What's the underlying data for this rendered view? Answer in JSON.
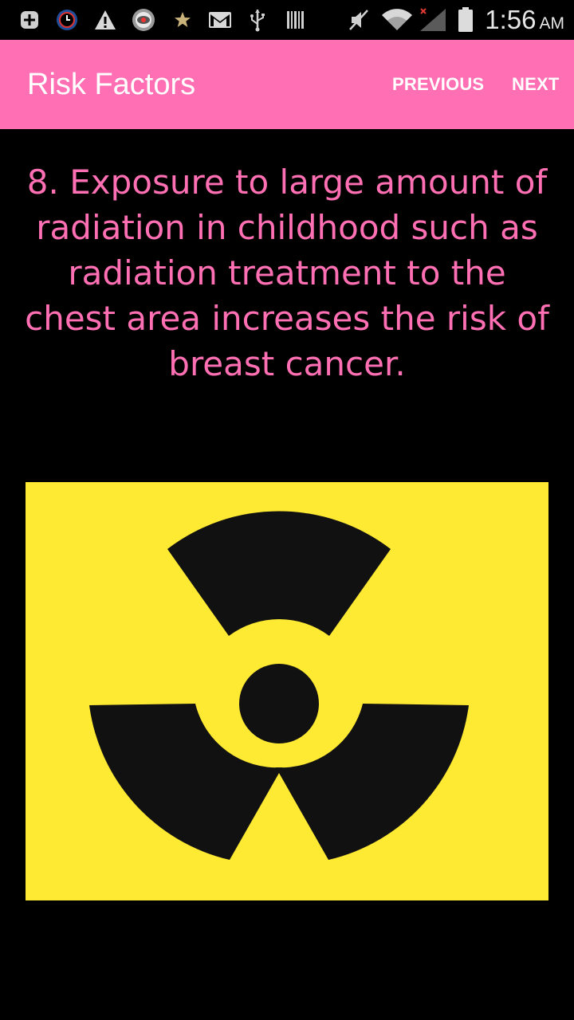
{
  "status_bar": {
    "time": "1:56",
    "ampm": "AM",
    "icons": [
      "plus-box-icon",
      "clock-app-icon",
      "warning-icon",
      "eye-app-icon",
      "star-icon",
      "gmail-icon",
      "usb-icon",
      "barcode-icon",
      "mute-icon",
      "wifi-icon",
      "signal-icon",
      "battery-icon"
    ]
  },
  "app_bar": {
    "title": "Risk Factors",
    "previous_label": "PREVIOUS",
    "next_label": "NEXT",
    "color": "#ff6fb3"
  },
  "content": {
    "fact": "8. Exposure to large amount of radiation in childhood such as radiation treatment to the chest area increases the risk of breast cancer.",
    "text_color": "#ff6fb3",
    "image_icon": "radiation-hazard-icon",
    "image_background": "#ffea33"
  }
}
